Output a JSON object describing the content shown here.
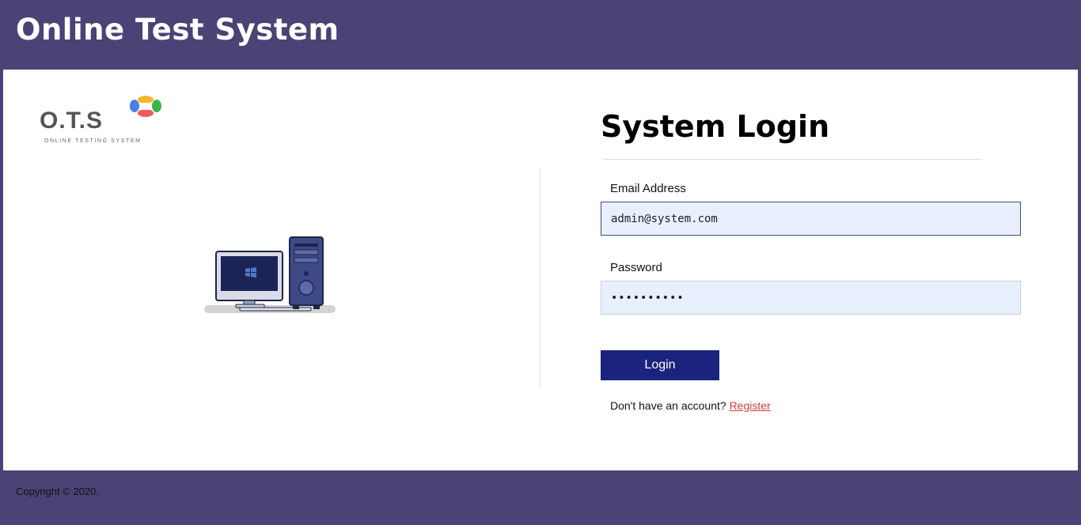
{
  "header": {
    "title": "Online Test System"
  },
  "logo": {
    "text": "O.T.S",
    "subtitle": "ONLINE TESTING SYSTEM"
  },
  "login": {
    "title": "System Login",
    "email_label": "Email Address",
    "email_value": "admin@system.com",
    "password_label": "Password",
    "password_value": "••••••••••",
    "button_label": "Login",
    "register_prompt": "Don't have an account?",
    "register_link": "Register"
  },
  "footer": {
    "copyright": "Copyright © 2020."
  },
  "colors": {
    "header_bg": "#4b4275",
    "button_bg": "#1a237e",
    "link": "#d23b3b",
    "input_bg": "#e8f0fe"
  },
  "icons": {
    "illustration": "desktop-computer-icon"
  }
}
